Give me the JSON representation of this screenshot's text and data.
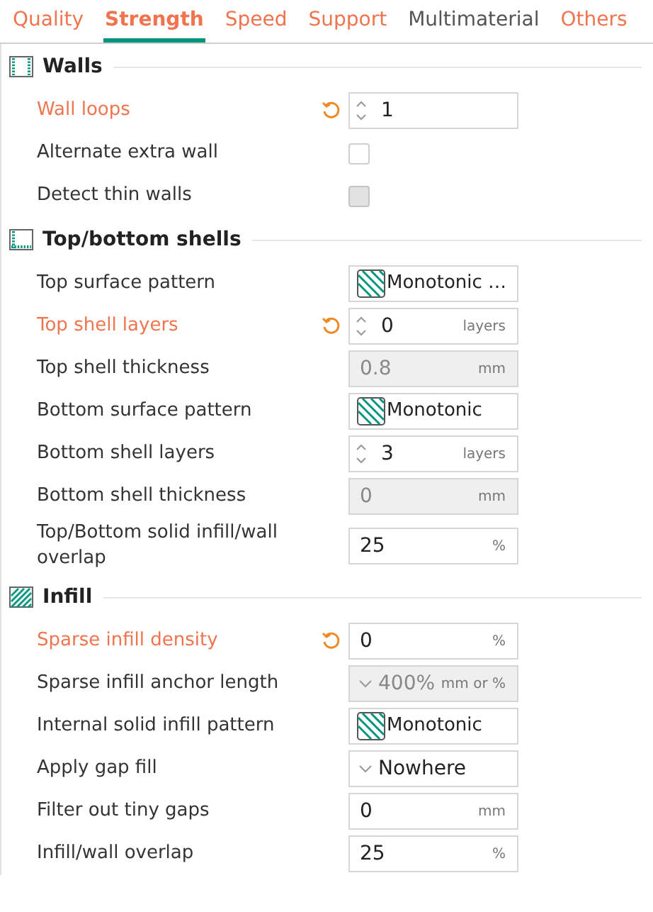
{
  "tabs": [
    {
      "label": "Quality",
      "selected": false,
      "modified": true
    },
    {
      "label": "Strength",
      "selected": true,
      "modified": true
    },
    {
      "label": "Speed",
      "selected": false,
      "modified": true
    },
    {
      "label": "Support",
      "selected": false,
      "modified": true
    },
    {
      "label": "Multimaterial",
      "selected": false,
      "modified": false
    },
    {
      "label": "Others",
      "selected": false,
      "modified": true
    }
  ],
  "sections": [
    {
      "title": "Walls",
      "kind": "walls",
      "rows": [
        {
          "label": "Wall loops",
          "modified": true,
          "kind": "spin",
          "value": "1",
          "disabled": false
        },
        {
          "label": "Alternate extra wall",
          "modified": false,
          "kind": "checkbox",
          "checked": false,
          "disabled": false
        },
        {
          "label": "Detect thin walls",
          "modified": false,
          "kind": "checkbox",
          "checked": false,
          "disabled": true
        }
      ]
    },
    {
      "title": "Top/bottom shells",
      "kind": "shells",
      "rows": [
        {
          "label": "Top surface pattern",
          "modified": false,
          "kind": "pattern",
          "value": "Monotonic …",
          "disabled": false
        },
        {
          "label": "Top shell layers",
          "modified": true,
          "kind": "spin",
          "value": "0",
          "unit": "layers",
          "disabled": false
        },
        {
          "label": "Top shell thickness",
          "modified": false,
          "kind": "number",
          "value": "0.8",
          "unit": "mm",
          "disabled": true
        },
        {
          "label": "Bottom surface pattern",
          "modified": false,
          "kind": "pattern",
          "value": "Monotonic",
          "disabled": false
        },
        {
          "label": "Bottom shell layers",
          "modified": false,
          "kind": "spin",
          "value": "3",
          "unit": "layers",
          "disabled": false
        },
        {
          "label": "Bottom shell thickness",
          "modified": false,
          "kind": "number",
          "value": "0",
          "unit": "mm",
          "disabled": true
        },
        {
          "label": "Top/Bottom solid infill/wall overlap",
          "modified": false,
          "kind": "number",
          "value": "25",
          "unit": "%",
          "disabled": false
        }
      ]
    },
    {
      "title": "Infill",
      "kind": "infill",
      "rows": [
        {
          "label": "Sparse infill density",
          "modified": true,
          "kind": "number",
          "value": "0",
          "unit": "%",
          "disabled": false
        },
        {
          "label": "Sparse infill anchor length",
          "modified": false,
          "kind": "combo",
          "value": "400%",
          "unit": "mm or %",
          "disabled": true
        },
        {
          "label": "Internal solid infill pattern",
          "modified": false,
          "kind": "pattern",
          "value": "Monotonic",
          "disabled": false
        },
        {
          "label": "Apply gap fill",
          "modified": false,
          "kind": "combo",
          "value": "Nowhere",
          "disabled": false
        },
        {
          "label": "Filter out tiny gaps",
          "modified": false,
          "kind": "number",
          "value": "0",
          "unit": "mm",
          "disabled": false
        },
        {
          "label": "Infill/wall overlap",
          "modified": false,
          "kind": "number",
          "value": "25",
          "unit": "%",
          "disabled": false
        }
      ]
    }
  ]
}
